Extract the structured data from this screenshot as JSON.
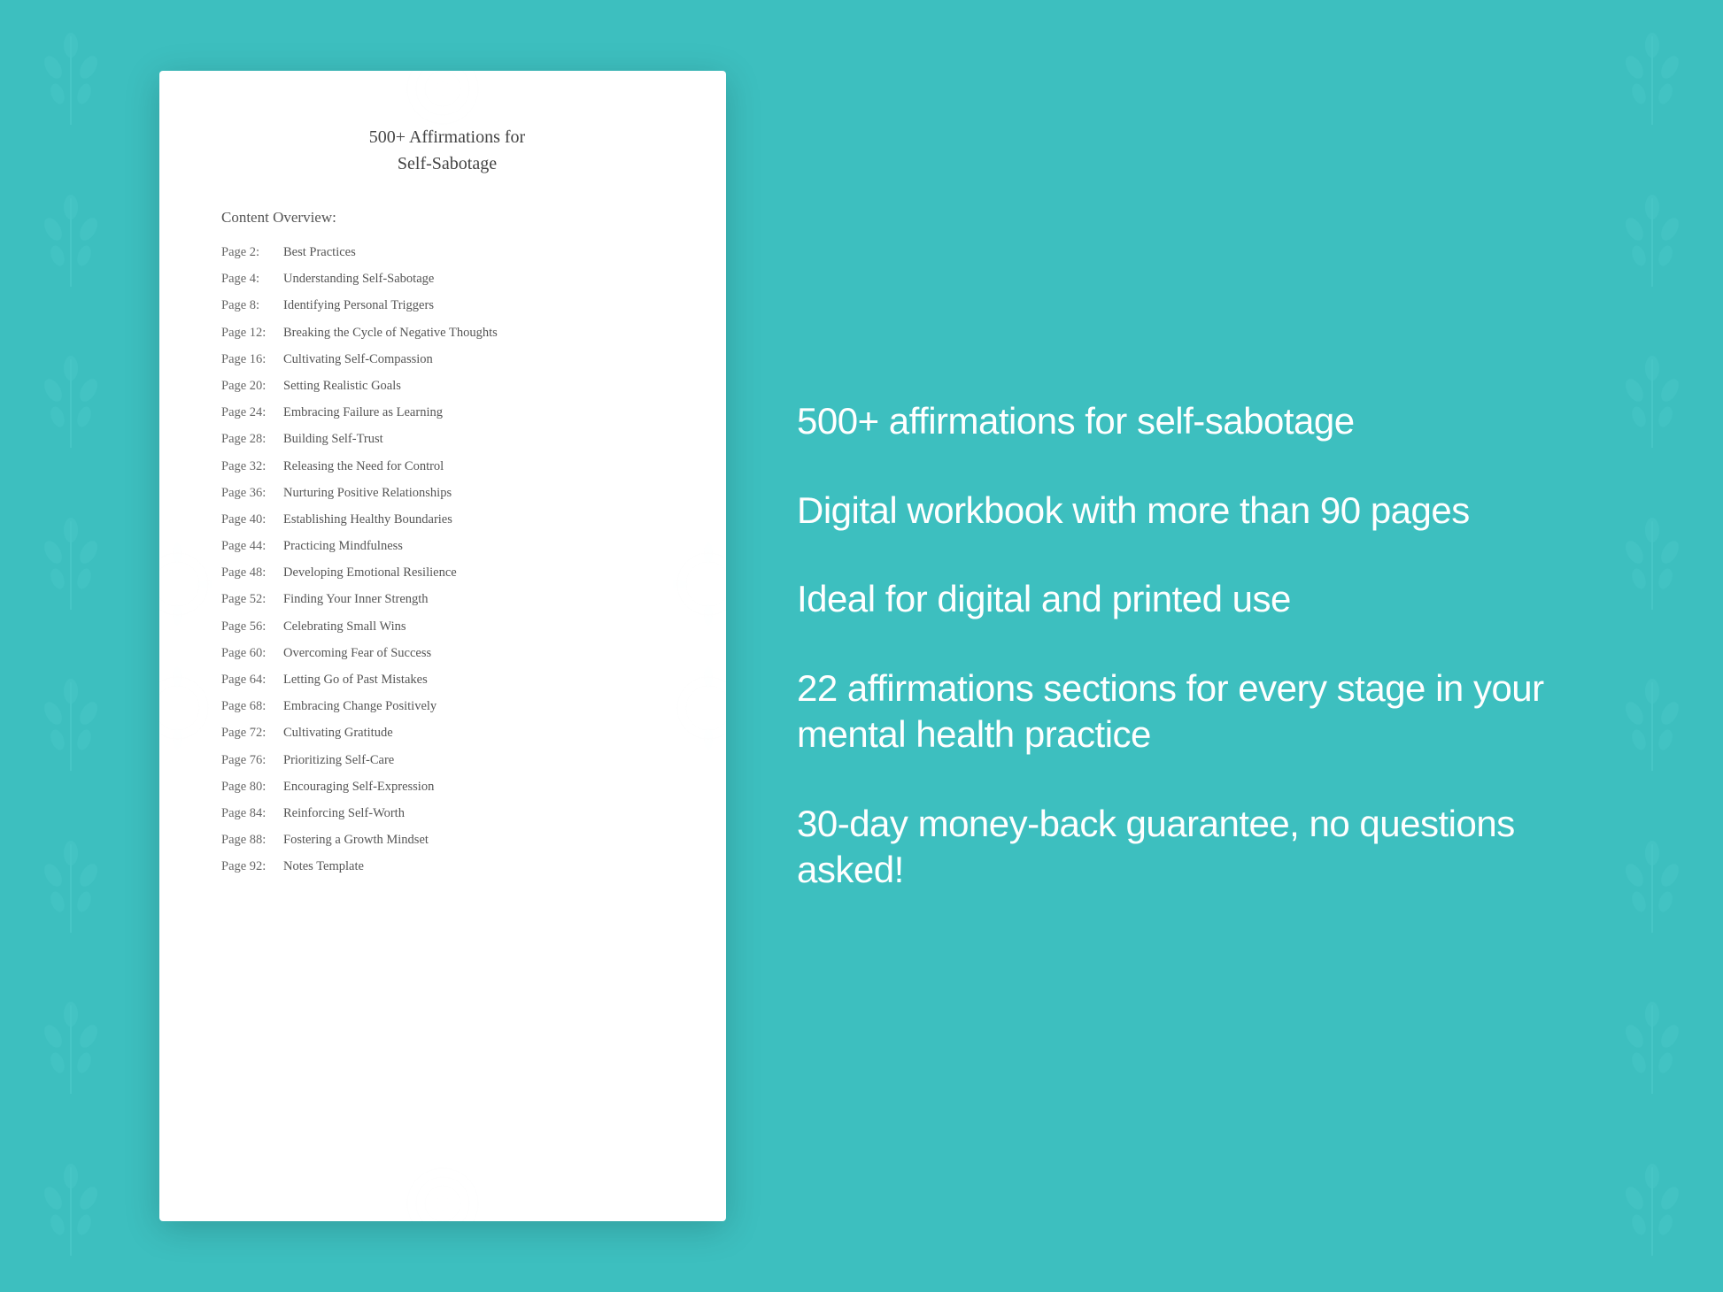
{
  "background": {
    "color": "#2eb5b5"
  },
  "document": {
    "title_line1": "500+ Affirmations for",
    "title_line2": "Self-Sabotage",
    "content_label": "Content Overview:",
    "toc_items": [
      {
        "page": "Page  2:",
        "title": "Best Practices"
      },
      {
        "page": "Page  4:",
        "title": "Understanding Self-Sabotage"
      },
      {
        "page": "Page  8:",
        "title": "Identifying Personal Triggers"
      },
      {
        "page": "Page 12:",
        "title": "Breaking the Cycle of Negative Thoughts"
      },
      {
        "page": "Page 16:",
        "title": "Cultivating Self-Compassion"
      },
      {
        "page": "Page 20:",
        "title": "Setting Realistic Goals"
      },
      {
        "page": "Page 24:",
        "title": "Embracing Failure as Learning"
      },
      {
        "page": "Page 28:",
        "title": "Building Self-Trust"
      },
      {
        "page": "Page 32:",
        "title": "Releasing the Need for Control"
      },
      {
        "page": "Page 36:",
        "title": "Nurturing Positive Relationships"
      },
      {
        "page": "Page 40:",
        "title": "Establishing Healthy Boundaries"
      },
      {
        "page": "Page 44:",
        "title": "Practicing Mindfulness"
      },
      {
        "page": "Page 48:",
        "title": "Developing Emotional Resilience"
      },
      {
        "page": "Page 52:",
        "title": "Finding Your Inner Strength"
      },
      {
        "page": "Page 56:",
        "title": "Celebrating Small Wins"
      },
      {
        "page": "Page 60:",
        "title": "Overcoming Fear of Success"
      },
      {
        "page": "Page 64:",
        "title": "Letting Go of Past Mistakes"
      },
      {
        "page": "Page 68:",
        "title": "Embracing Change Positively"
      },
      {
        "page": "Page 72:",
        "title": "Cultivating Gratitude"
      },
      {
        "page": "Page 76:",
        "title": "Prioritizing Self-Care"
      },
      {
        "page": "Page 80:",
        "title": "Encouraging Self-Expression"
      },
      {
        "page": "Page 84:",
        "title": "Reinforcing Self-Worth"
      },
      {
        "page": "Page 88:",
        "title": "Fostering a Growth Mindset"
      },
      {
        "page": "Page 92:",
        "title": "Notes Template"
      }
    ]
  },
  "features": [
    "500+ affirmations for\nself-sabotage",
    "Digital workbook with\nmore than 90 pages",
    "Ideal for digital and\nprinted use",
    "22 affirmations sections\nfor every stage in your\nmental health practice",
    "30-day money-back\nguarantee, no\nquestions asked!"
  ]
}
